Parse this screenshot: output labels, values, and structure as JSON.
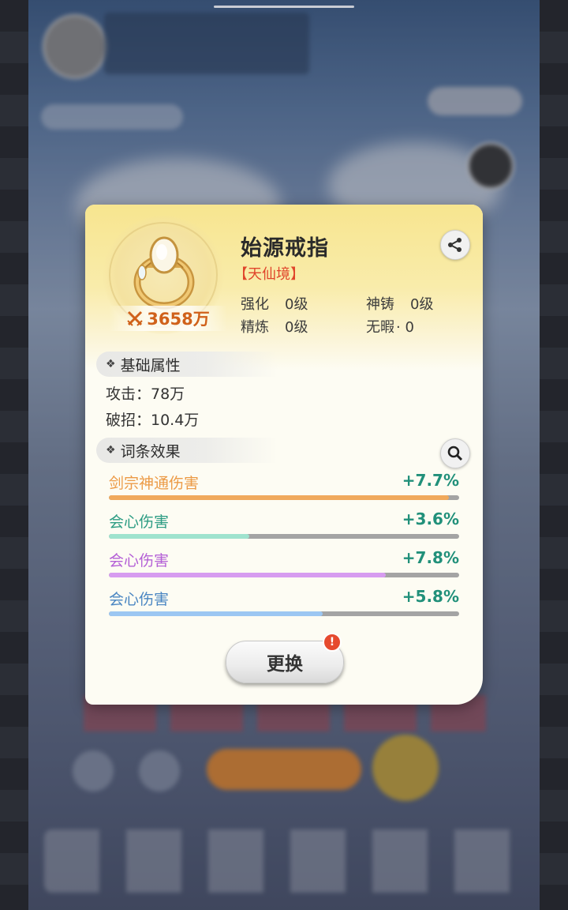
{
  "background": {
    "description_hidden": true
  },
  "item": {
    "name": "始源戒指",
    "realm": "【天仙境】",
    "power": "3658万",
    "stats": {
      "strengthen_label": "强化",
      "strengthen_value": "0级",
      "divine_cast_label": "神铸",
      "divine_cast_value": "0级",
      "refine_label": "精炼",
      "refine_value": "0级",
      "flawless_label": "无暇",
      "flawless_value": "· 0"
    }
  },
  "base_attributes": {
    "title": "基础属性",
    "lines": [
      "攻击：78万",
      "破招：10.4万"
    ]
  },
  "affixes": {
    "title": "词条效果",
    "items": [
      {
        "name": "剑宗神通伤害",
        "value": "+7.7%",
        "fill": 0.97,
        "color": "#f0a95c"
      },
      {
        "name": "会心伤害",
        "value": "+3.6%",
        "fill": 0.4,
        "color": "#9fe3ce"
      },
      {
        "name": "会心伤害",
        "value": "+7.8%",
        "fill": 0.79,
        "color": "#d79cf0"
      },
      {
        "name": "会心伤害",
        "value": "+5.8%",
        "fill": 0.61,
        "color": "#9cc7f2"
      }
    ],
    "name_colors": [
      "#ec9a45",
      "#2c9c83",
      "#b45fd6",
      "#4a86c2"
    ]
  },
  "actions": {
    "swap_label": "更换",
    "alert_badge": "!"
  },
  "icons": {
    "share": "share-icon",
    "search": "search-icon",
    "power": "crossed-swords-icon"
  }
}
